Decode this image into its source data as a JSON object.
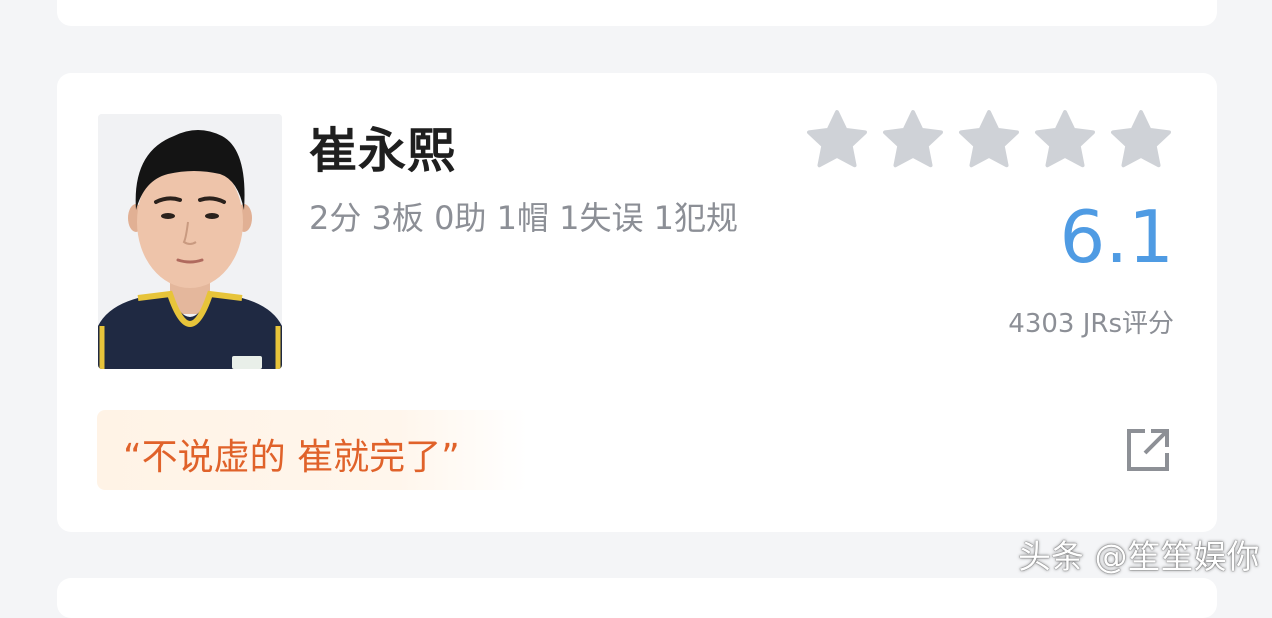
{
  "player": {
    "name": "崔永熙",
    "stats": "2分 3板 0助 1帽 1失误 1犯规"
  },
  "rating": {
    "stars_filled": 0,
    "stars_total": 5,
    "star_color": "#cfd2d7",
    "score": "6.1",
    "score_color": "#4f9be3",
    "count_label": "4303 JRs评分"
  },
  "comment": {
    "quote": "“不说虚的 崔就完了”",
    "quote_color": "#e0622a"
  },
  "actions": {
    "share_icon": "external-link-icon"
  },
  "watermark": "头条 @笙笙娱你"
}
